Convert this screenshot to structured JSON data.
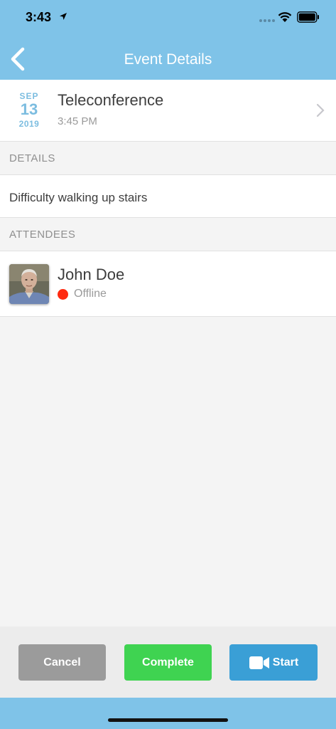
{
  "status_bar": {
    "time": "3:43"
  },
  "nav": {
    "title": "Event Details"
  },
  "event": {
    "month": "SEP",
    "day": "13",
    "year": "2019",
    "title": "Teleconference",
    "time": "3:45 PM"
  },
  "details": {
    "header": "DETAILS",
    "text": "Difficulty walking up stairs"
  },
  "attendees": {
    "header": "ATTENDEES",
    "items": [
      {
        "name": "John Doe",
        "status": "Offline",
        "status_color": "#ff2a10"
      }
    ]
  },
  "actions": {
    "cancel_label": "Cancel",
    "complete_label": "Complete",
    "start_label": "Start"
  },
  "colors": {
    "header_blue": "#7fc3e8",
    "date_blue": "#7cbde0",
    "cancel_gray": "#9b9b9b",
    "complete_green": "#3fd351",
    "start_blue": "#3a9fd6"
  }
}
